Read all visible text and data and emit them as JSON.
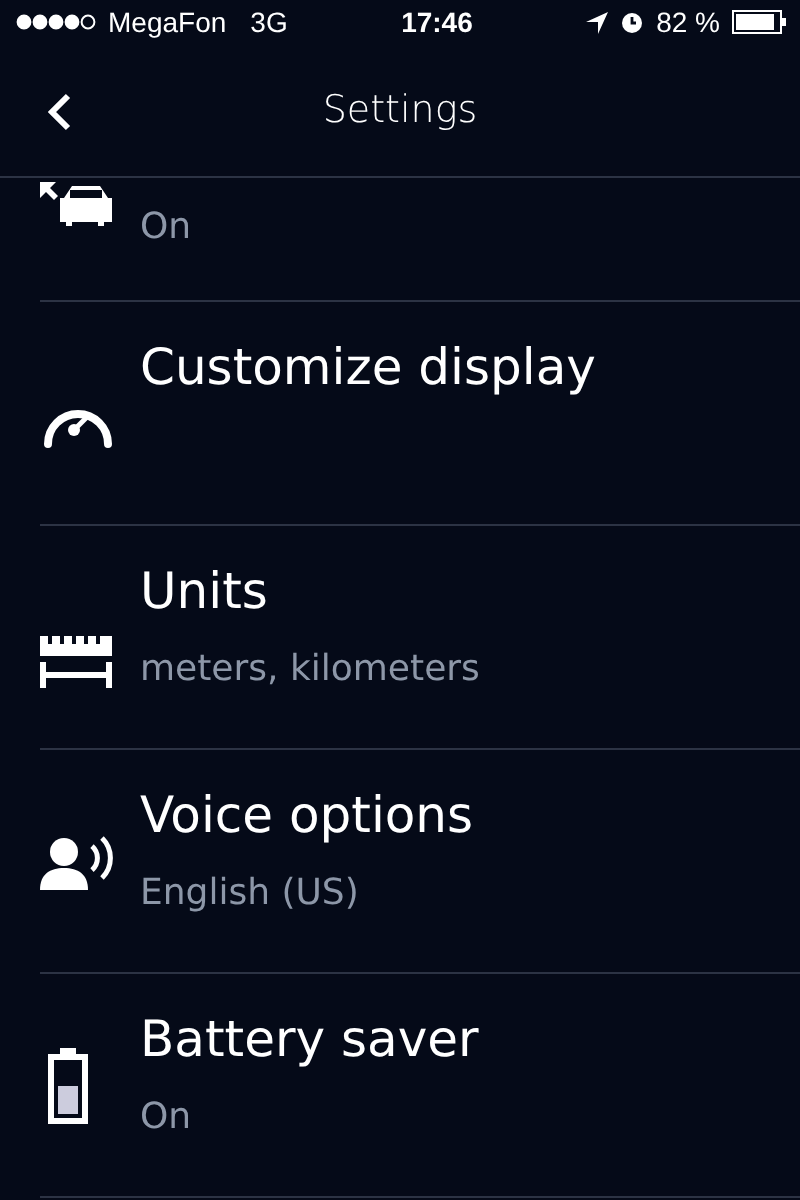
{
  "status_bar": {
    "carrier": "MegaFon",
    "network": "3G",
    "time": "17:46",
    "battery_percent": "82 %"
  },
  "nav": {
    "title": "Settings"
  },
  "settings": [
    {
      "subtitle": "On"
    },
    {
      "title": "Customize display"
    },
    {
      "title": "Units",
      "subtitle": "meters, kilometers"
    },
    {
      "title": "Voice options",
      "subtitle": "English (US)"
    },
    {
      "title": "Battery saver",
      "subtitle": "On"
    }
  ]
}
